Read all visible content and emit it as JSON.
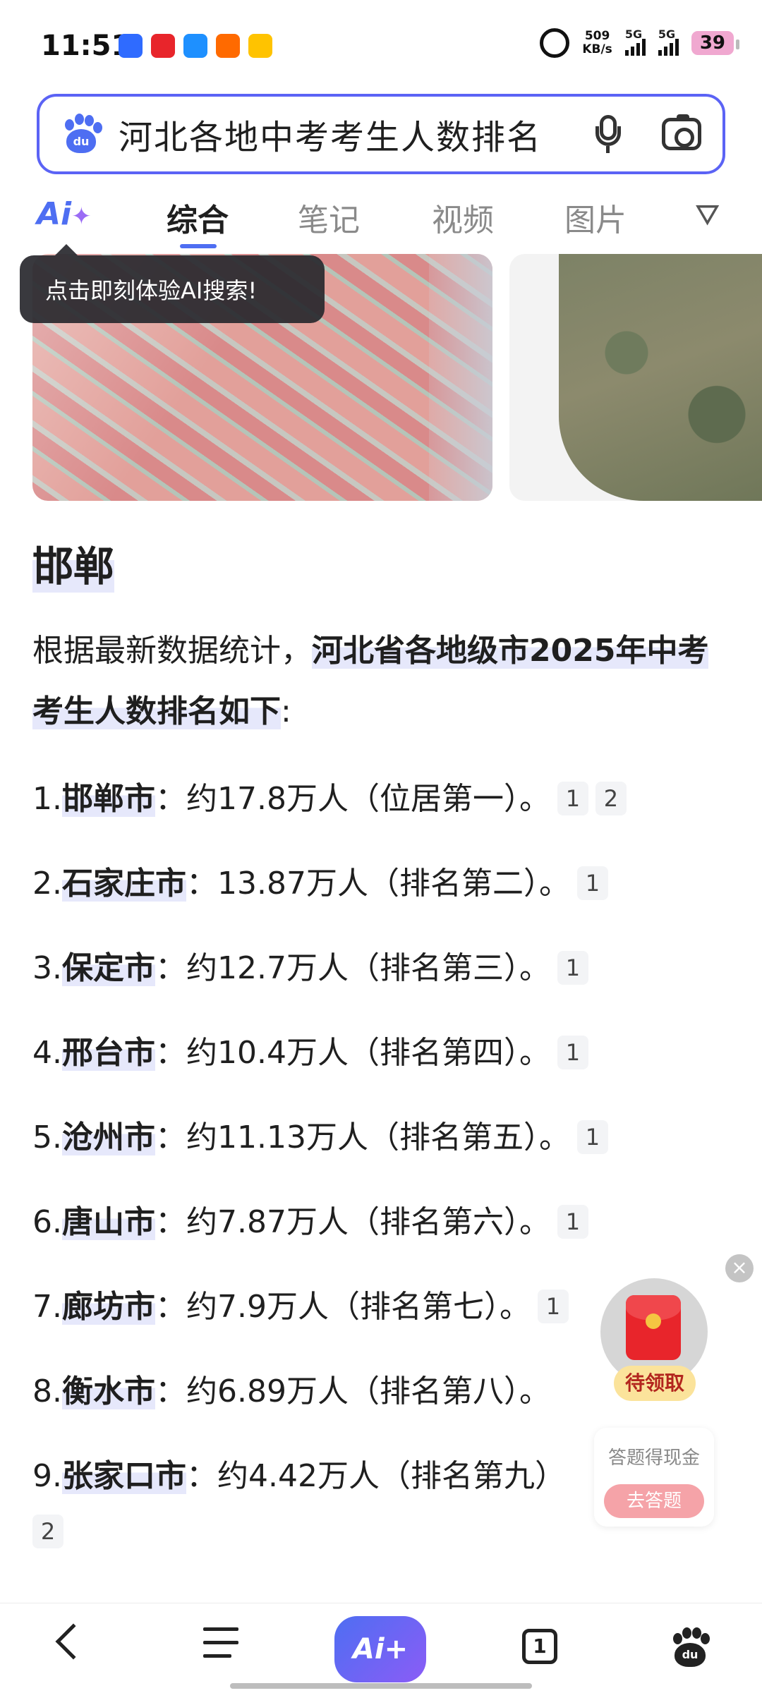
{
  "status_bar": {
    "time": "11:51",
    "net_speed_value": "509",
    "net_speed_unit": "KB/s",
    "signal_1_label": "5G",
    "signal_2_label": "5G",
    "battery": "39"
  },
  "search": {
    "query": "河北各地中考考生人数排名",
    "logo_text": "du"
  },
  "tabs": {
    "ai_label": "Ai",
    "items": [
      "综合",
      "笔记",
      "视频",
      "图片"
    ],
    "active": "综合"
  },
  "tooltip": "点击即刻体验AI搜索!",
  "article": {
    "heading": "邯郸",
    "intro_prefix": "根据最新数据统计，",
    "intro_highlight": "河北省各地级市2025年中考考生人数排名如下",
    "intro_suffix": ":",
    "items": [
      {
        "num": "1.",
        "city": "邯郸市",
        "text": "：约17.8万人（位居第一）。",
        "cites": [
          "1",
          "2"
        ]
      },
      {
        "num": "2.",
        "city": "石家庄市",
        "text": "：13.87万人（排名第二）。",
        "cites": [
          "1"
        ]
      },
      {
        "num": "3.",
        "city": "保定市",
        "text": "：约12.7万人（排名第三）。",
        "cites": [
          "1"
        ]
      },
      {
        "num": "4.",
        "city": "邢台市",
        "text": "：约10.4万人（排名第四）。",
        "cites": [
          "1"
        ]
      },
      {
        "num": "5.",
        "city": "沧州市",
        "text": "：约11.13万人（排名第五）。",
        "cites": [
          "1"
        ]
      },
      {
        "num": "6.",
        "city": "唐山市",
        "text": "：约7.87万人（排名第六）。",
        "cites": [
          "1"
        ]
      },
      {
        "num": "7.",
        "city": "廊坊市",
        "text": "：约7.9万人（排名第七）。",
        "cites": [
          "1"
        ]
      },
      {
        "num": "8.",
        "city": "衡水市",
        "text": "：约6.89万人（排名第八）。",
        "cites": []
      },
      {
        "num": "9.",
        "city": "张家口市",
        "text": "：约4.42万人（排名第九）",
        "cites": []
      }
    ],
    "item9_cite": "2"
  },
  "float_widget": {
    "close": "×",
    "packet_label": "待领取",
    "quiz_title": "答题得现金",
    "quiz_button": "去答题"
  },
  "bottom_nav": {
    "ai_label": "Ai+",
    "tab_count": "1",
    "home_logo_text": "du"
  }
}
